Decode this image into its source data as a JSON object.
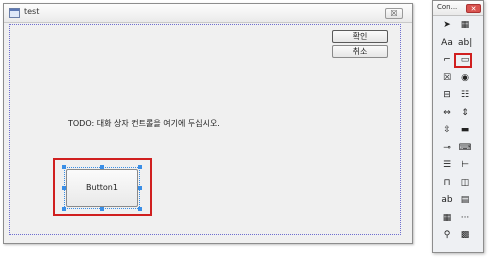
{
  "dialog": {
    "title": "test",
    "close_glyph": "☒",
    "ok_label": "확인",
    "cancel_label": "취소",
    "todo_text": "TODO: 대화 상자 컨트롤을 여기에 두십시오.",
    "selected_button_label": "Button1"
  },
  "toolbox": {
    "title": "Con...",
    "close_glyph": "✕",
    "tools": [
      {
        "icon": "pointer-icon",
        "glyph": "➤"
      },
      {
        "icon": "picture-icon",
        "glyph": "▦"
      },
      {
        "icon": "static-text-icon",
        "glyph": "Aa"
      },
      {
        "icon": "edit-box-icon",
        "glyph": "ab|"
      },
      {
        "icon": "group-box-icon",
        "glyph": "⌐"
      },
      {
        "icon": "button-icon",
        "glyph": "▭"
      },
      {
        "icon": "check-box-icon",
        "glyph": "☒"
      },
      {
        "icon": "radio-button-icon",
        "glyph": "◉"
      },
      {
        "icon": "combo-box-icon",
        "glyph": "⊟"
      },
      {
        "icon": "list-box-icon",
        "glyph": "☷"
      },
      {
        "icon": "horizontal-scroll-icon",
        "glyph": "⇔"
      },
      {
        "icon": "vertical-scroll-icon",
        "glyph": "⇕"
      },
      {
        "icon": "spin-icon",
        "glyph": "⇳"
      },
      {
        "icon": "progress-icon",
        "glyph": "▬"
      },
      {
        "icon": "slider-icon",
        "glyph": "⊸"
      },
      {
        "icon": "hotkey-icon",
        "glyph": "⌨"
      },
      {
        "icon": "list-control-icon",
        "glyph": "☰"
      },
      {
        "icon": "tree-control-icon",
        "glyph": "⊢"
      },
      {
        "icon": "tab-control-icon",
        "glyph": "⊓"
      },
      {
        "icon": "animate-icon",
        "glyph": "◫"
      },
      {
        "icon": "rich-edit-icon",
        "glyph": "ab"
      },
      {
        "icon": "date-picker-icon",
        "glyph": "▤"
      },
      {
        "icon": "month-calendar-icon",
        "glyph": "▦"
      },
      {
        "icon": "ip-address-icon",
        "glyph": "···"
      },
      {
        "icon": "syslink-icon",
        "glyph": "⚲"
      },
      {
        "icon": "extended-combo-icon",
        "glyph": "▩"
      }
    ]
  },
  "colors": {
    "highlight_red": "#d01f1f",
    "selection_blue": "#3a8ee6",
    "guide_dotted": "#6f6fd0"
  }
}
